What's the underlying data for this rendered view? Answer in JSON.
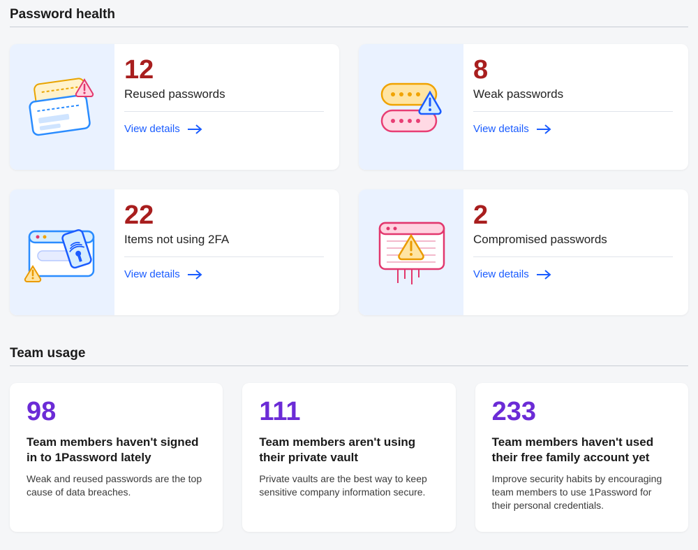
{
  "sections": {
    "password_health": {
      "title": "Password health"
    },
    "team_usage": {
      "title": "Team usage"
    }
  },
  "link_label": "View details",
  "password_health": {
    "cards": [
      {
        "count": "12",
        "label": "Reused passwords"
      },
      {
        "count": "8",
        "label": "Weak passwords"
      },
      {
        "count": "22",
        "label": "Items not using 2FA"
      },
      {
        "count": "2",
        "label": "Compromised passwords"
      }
    ]
  },
  "team_usage": {
    "cards": [
      {
        "count": "98",
        "title": "Team members haven't signed in to 1Password lately",
        "desc": "Weak and reused passwords are the top cause of data breaches."
      },
      {
        "count": "111",
        "title": "Team members aren't using their private vault",
        "desc": "Private vaults are the best way to keep sensitive company information secure."
      },
      {
        "count": "233",
        "title": "Team members haven't used their free family account yet",
        "desc": "Improve security habits by encouraging team members to use 1Password for their personal credentials."
      }
    ]
  },
  "colors": {
    "danger_count": "#a81e1e",
    "accent_count": "#6b2bd6",
    "link": "#1a5cff"
  }
}
